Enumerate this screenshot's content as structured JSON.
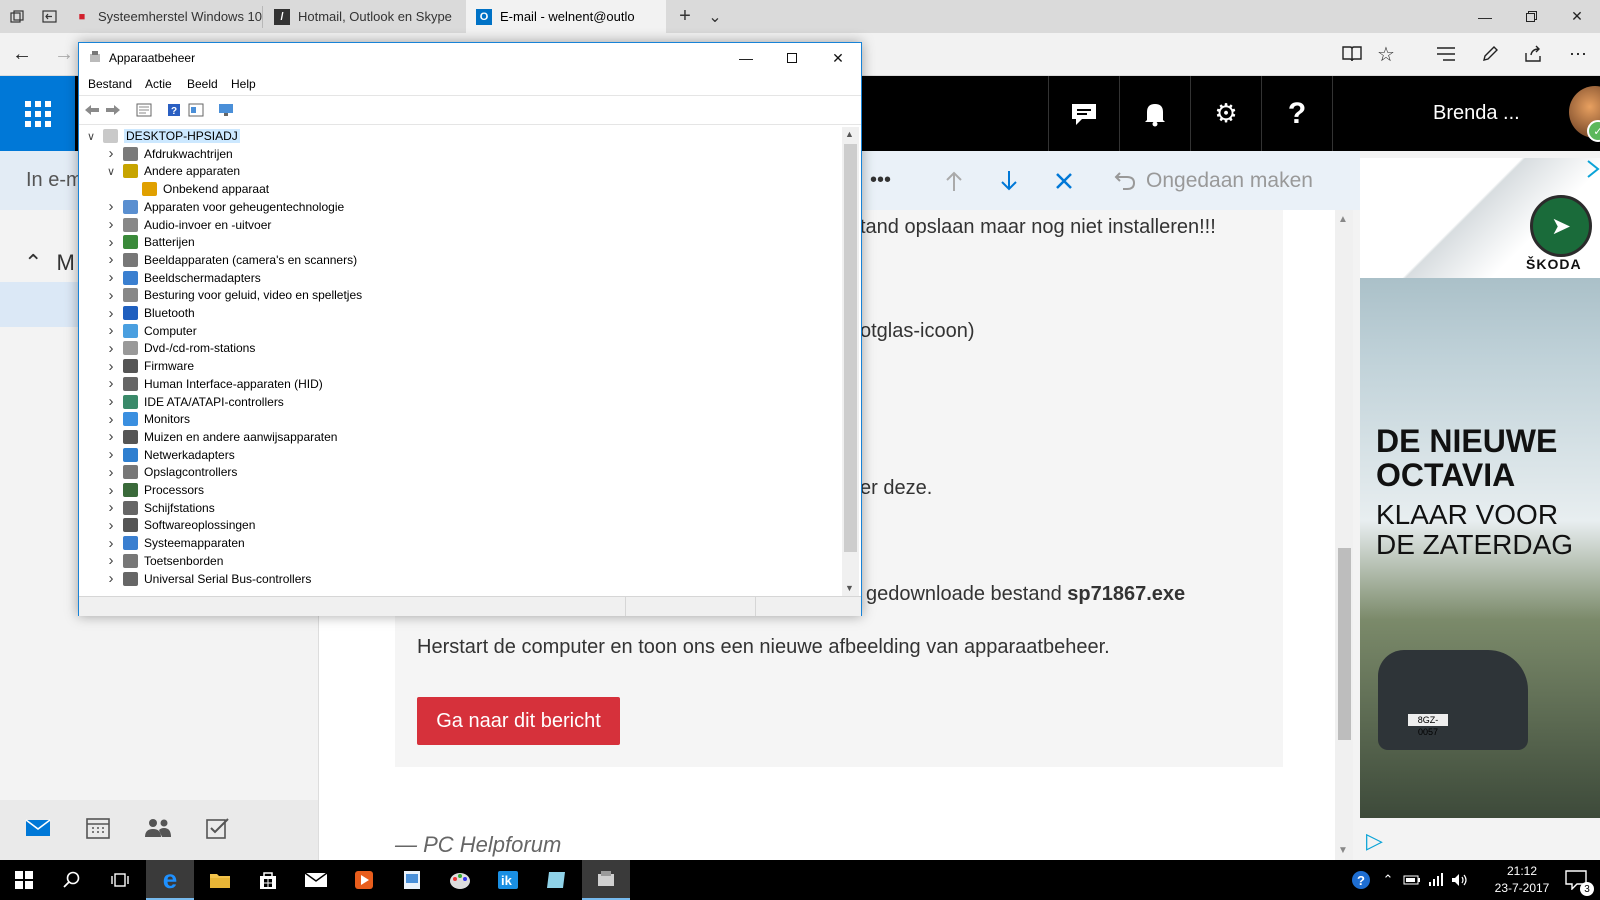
{
  "browser": {
    "tabs": [
      {
        "title": "Systeemherstel Windows 10",
        "active": false
      },
      {
        "title": "Hotmail, Outlook en Skype",
        "active": false
      },
      {
        "title": "E-mail - welnent@outlo",
        "active": true
      }
    ],
    "new_tab_symbol": "+",
    "tab_list_symbol": "⌄"
  },
  "outlook": {
    "user_name": "Brenda ...",
    "command": {
      "more": "•••",
      "undo_label": "Ongedaan maken"
    },
    "left": {
      "search_partial": "In e-m",
      "folder_partial": "M"
    },
    "message": {
      "line1": "tand opslaan maar nog niet installeren!!!",
      "line2": "otglas-icoon)",
      "line3": "er deze.",
      "line4_pre": "gedownloade bestand ",
      "line4_bold": "sp71867.exe",
      "line5": "Herstart de computer en toon ons een nieuwe afbeelding van apparaatbeheer.",
      "button": "Ga naar dit bericht",
      "signature": "— PC Helpforum"
    }
  },
  "ad": {
    "brand": "ŠKODA",
    "headline1": "DE NIEUWE",
    "headline2": "OCTAVIA",
    "sub1": "KLAAR VOOR",
    "sub2": "DE ZATERDAG",
    "plate": "8GZ-0057"
  },
  "taskbar": {
    "time": "21:12",
    "date": "23-7-2017",
    "notifications": "3"
  },
  "device_manager": {
    "title": "Apparaatbeheer",
    "menu": [
      "Bestand",
      "Actie",
      "Beeld",
      "Help"
    ],
    "root": "DESKTOP-HPSIADJ",
    "tree": [
      {
        "label": "Afdrukwachtrijen",
        "level": 1,
        "expanded": false
      },
      {
        "label": "Andere apparaten",
        "level": 1,
        "expanded": true
      },
      {
        "label": "Onbekend apparaat",
        "level": 2,
        "expanded": null
      },
      {
        "label": "Apparaten voor geheugentechnologie",
        "level": 1,
        "expanded": false
      },
      {
        "label": "Audio-invoer en -uitvoer",
        "level": 1,
        "expanded": false
      },
      {
        "label": "Batterijen",
        "level": 1,
        "expanded": false
      },
      {
        "label": "Beeldapparaten (camera's en scanners)",
        "level": 1,
        "expanded": false
      },
      {
        "label": "Beeldschermadapters",
        "level": 1,
        "expanded": false
      },
      {
        "label": "Besturing voor geluid, video en spelletjes",
        "level": 1,
        "expanded": false
      },
      {
        "label": "Bluetooth",
        "level": 1,
        "expanded": false
      },
      {
        "label": "Computer",
        "level": 1,
        "expanded": false
      },
      {
        "label": "Dvd-/cd-rom-stations",
        "level": 1,
        "expanded": false
      },
      {
        "label": "Firmware",
        "level": 1,
        "expanded": false
      },
      {
        "label": "Human Interface-apparaten (HID)",
        "level": 1,
        "expanded": false
      },
      {
        "label": "IDE ATA/ATAPI-controllers",
        "level": 1,
        "expanded": false
      },
      {
        "label": "Monitors",
        "level": 1,
        "expanded": false
      },
      {
        "label": "Muizen en andere aanwijsapparaten",
        "level": 1,
        "expanded": false
      },
      {
        "label": "Netwerkadapters",
        "level": 1,
        "expanded": false
      },
      {
        "label": "Opslagcontrollers",
        "level": 1,
        "expanded": false
      },
      {
        "label": "Processors",
        "level": 1,
        "expanded": false
      },
      {
        "label": "Schijfstations",
        "level": 1,
        "expanded": false
      },
      {
        "label": "Softwareoplossingen",
        "level": 1,
        "expanded": false
      },
      {
        "label": "Systeemapparaten",
        "level": 1,
        "expanded": false
      },
      {
        "label": "Toetsenborden",
        "level": 1,
        "expanded": false
      },
      {
        "label": "Universal Serial Bus-controllers",
        "level": 1,
        "expanded": false
      }
    ]
  },
  "colors": {
    "outlook_blue": "#0078d7",
    "header_black": "#000000",
    "button_red": "#d6313b",
    "selection": "#cce8ff"
  }
}
